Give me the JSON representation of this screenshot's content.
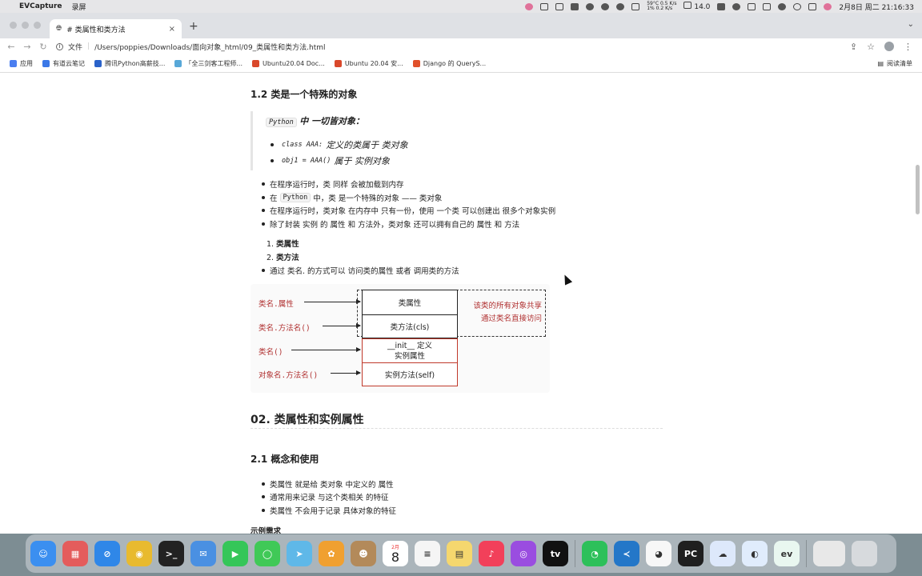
{
  "menubar": {
    "app_name": "EVCapture",
    "menu_item": "录屏",
    "cpu_temp": "59°C",
    "cpu_pct": "1%",
    "net_up": "0.5 K/s",
    "net_down": "0.2 K/s",
    "battery_pct": "14.0",
    "datetime": "2月8日 周二 21:16:33"
  },
  "browser": {
    "tab_title": "# 类属性和类方法",
    "url_label": "文件",
    "url": "/Users/poppies/Downloads/面向对象_html/09_类属性和类方法.html",
    "bookmarks": [
      {
        "label": "应用",
        "color": "#4a7ef0"
      },
      {
        "label": "有道云笔记",
        "color": "#3b78e7"
      },
      {
        "label": "腾讯Python高薪技...",
        "color": "#2a62c9"
      },
      {
        "label": "「全三剑客工程师...",
        "color": "#58a8d8"
      },
      {
        "label": "Ubuntu20.04 Doc...",
        "color": "#d9482b"
      },
      {
        "label": "Ubuntu 20.04 安...",
        "color": "#d9482b"
      },
      {
        "label": "Django 的 QueryS...",
        "color": "#e0502a"
      }
    ],
    "reading_list": "阅读清单"
  },
  "doc": {
    "h3_1": "1.2 类是一个特殊的对象",
    "quote_code": "Python",
    "quote_text": "中 一切皆对象：",
    "quote_item1_code": "class AAA:",
    "quote_item1_text": "定义的类属于 类对象",
    "quote_item2_code": "obj1 = AAA()",
    "quote_item2_text": "属于 实例对象",
    "bullets": [
      "在程序运行时，类 同样 会被加载到内存",
      "中，类 是一个特殊的对象 —— 类对象",
      "在程序运行时，类对象 在内存中 只有一份，使用 一个类 可以创建出 很多个对象实例",
      "除了封装 实例 的 属性 和 方法外，类对象 还可以拥有自己的 属性 和 方法"
    ],
    "bullet2_prefix": "在",
    "bullet2_code": "Python",
    "numbered": [
      "类属性",
      "类方法"
    ],
    "num_prefix": [
      "1.",
      "2."
    ],
    "bullet_last": "通过 类名. 的方式可以 访问类的属性 或者 调用类的方法",
    "diagram": {
      "labels": [
        "类名.属性",
        "类名.方法名()",
        "类名()",
        "对象名.方法名()"
      ],
      "box1": "类属性",
      "box2": "类方法(cls)",
      "box3_a": "__init__ 定义",
      "box3_b": "实例属性",
      "box4": "实例方法(self)",
      "note_1": "该类的所有对象共享",
      "note_2": "通过类名直接访问"
    },
    "h2": "02. 类属性和实例属性",
    "h3_2": "2.1 概念和使用",
    "bullets2": [
      "类属性 就是给 类对象 中定义的 属性",
      "通常用来记录 与这个类相关 的特征",
      "类属性 不会用于记录 具体对象的特征"
    ],
    "example_heading": "示例需求"
  },
  "dock": {
    "calendar_month": "2月",
    "calendar_day": "8",
    "icons": [
      {
        "name": "finder-icon",
        "color": "#3b8ff0",
        "glyph": "☺"
      },
      {
        "name": "launchpad-icon",
        "color": "#e45c5c",
        "glyph": "▦"
      },
      {
        "name": "safari-icon",
        "color": "#2f87e8",
        "glyph": "⊘"
      },
      {
        "name": "chrome-icon",
        "color": "#e8ba2f",
        "glyph": "◉"
      },
      {
        "name": "terminal-icon",
        "color": "#222222",
        "glyph": ">_"
      },
      {
        "name": "mail-icon",
        "color": "#4a90e2",
        "glyph": "✉"
      },
      {
        "name": "facetime-icon",
        "color": "#35c659",
        "glyph": "▶"
      },
      {
        "name": "messages-icon",
        "color": "#40c957",
        "glyph": "◯"
      },
      {
        "name": "maps-icon",
        "color": "#5fb8e8",
        "glyph": "➤"
      },
      {
        "name": "photos-icon",
        "color": "#f0a030",
        "glyph": "✿"
      },
      {
        "name": "contacts-icon",
        "color": "#b38a5a",
        "glyph": "☻"
      }
    ],
    "icons2": [
      {
        "name": "reminders-icon",
        "color": "#f5f5f5",
        "glyph": "≡"
      },
      {
        "name": "notes-icon",
        "color": "#f5d76e",
        "glyph": "▤"
      },
      {
        "name": "music-icon",
        "color": "#f2405a",
        "glyph": "♪"
      },
      {
        "name": "podcasts-icon",
        "color": "#9a4de0",
        "glyph": "◎"
      },
      {
        "name": "appletv-icon",
        "color": "#111111",
        "glyph": "tv"
      },
      {
        "name": "wechat-icon",
        "color": "#2dc05a",
        "glyph": "◔"
      },
      {
        "name": "vscode-icon",
        "color": "#2477c8",
        "glyph": "≺"
      },
      {
        "name": "qq-icon",
        "color": "#f7f7f7",
        "glyph": "◕"
      },
      {
        "name": "pycharm-icon",
        "color": "#1f1f1f",
        "glyph": "PC"
      },
      {
        "name": "baidu-netdisk-icon",
        "color": "#dde8fb",
        "glyph": "☁"
      },
      {
        "name": "tencent-meeting-icon",
        "color": "#e0ecfc",
        "glyph": "◐"
      },
      {
        "name": "evcapture-icon",
        "color": "#e9f7f0",
        "glyph": "ev"
      }
    ]
  }
}
